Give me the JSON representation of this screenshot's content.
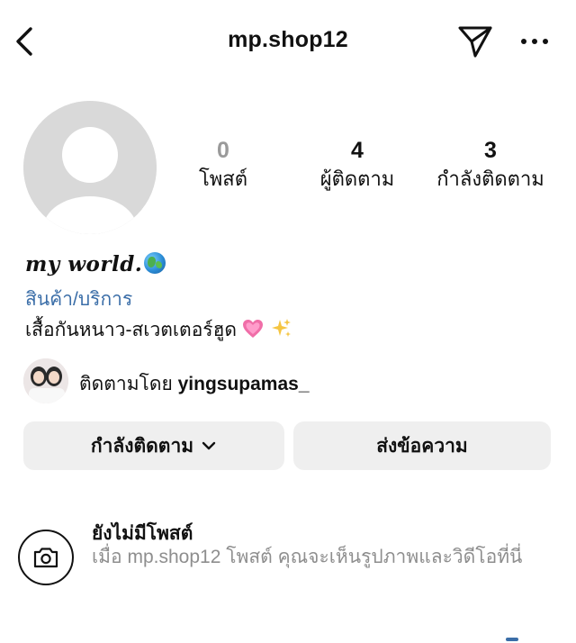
{
  "header": {
    "username": "mp.shop12",
    "back_icon": "chevron-left-icon",
    "send_icon": "send-icon",
    "more_icon": "more-horizontal-icon"
  },
  "stats": {
    "posts": {
      "count": "0",
      "label": "โพสต์"
    },
    "followers": {
      "count": "4",
      "label": "ผู้ติดตาม"
    },
    "following": {
      "count": "3",
      "label": "กำลังติดตาม"
    }
  },
  "profile": {
    "display_name": "𝒎𝒚 𝒘𝒐𝒓𝒍𝒅.",
    "category": "สินค้า/บริการ",
    "bio": "เสื้อกันหนาว-สเวตเตอร์ฮูด"
  },
  "followed_by": {
    "prefix": "ติดตามโดย",
    "user": "yingsupamas_"
  },
  "actions": {
    "following_label": "กำลังติดตาม",
    "message_label": "ส่งข้อความ"
  },
  "empty_state": {
    "title": "ยังไม่มีโพสต์",
    "description": "เมื่อ mp.shop12 โพสต์ คุณจะเห็นรูปภาพและวิดีโอที่นี่"
  },
  "colors": {
    "link": "#3b6ea8",
    "button_bg": "#efefef",
    "muted_text": "#8e8e8e",
    "avatar_placeholder": "#d9d9d9"
  }
}
